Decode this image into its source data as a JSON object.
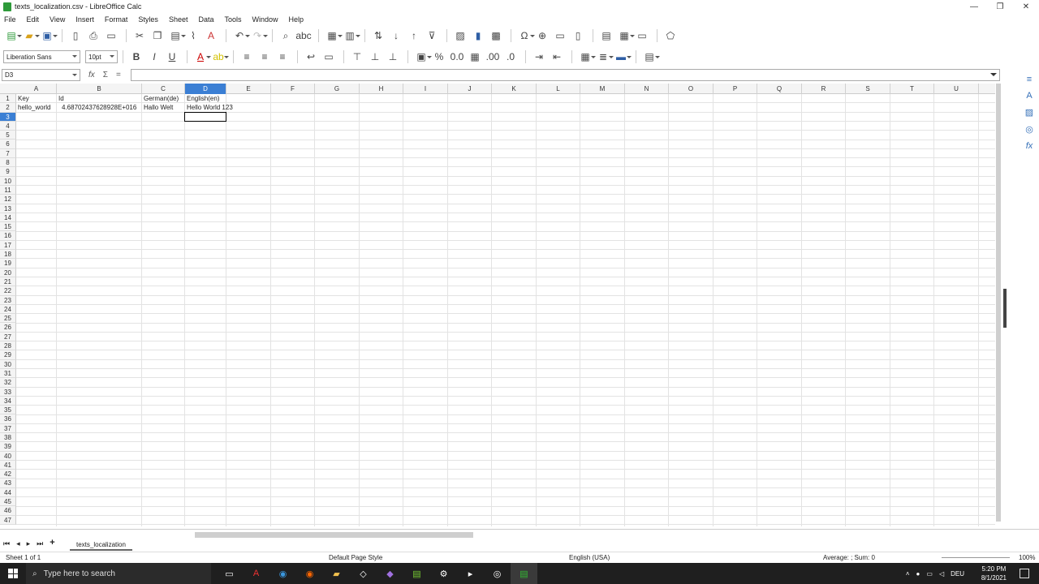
{
  "window": {
    "title": "texts_localization.csv - LibreOffice Calc",
    "controls": [
      "—",
      "❐",
      "✕"
    ]
  },
  "menu": [
    "File",
    "Edit",
    "View",
    "Insert",
    "Format",
    "Styles",
    "Sheet",
    "Data",
    "Tools",
    "Window",
    "Help"
  ],
  "toolbar": {
    "font_name": "Liberation Sans",
    "font_size": "10pt"
  },
  "formula_bar": {
    "cell_ref": "D3",
    "fx": "fx",
    "sum": "Σ",
    "equals": "=",
    "content": ""
  },
  "columns": [
    "A",
    "B",
    "C",
    "D",
    "E",
    "F",
    "G",
    "H",
    "I",
    "J",
    "K",
    "L",
    "M",
    "N",
    "O",
    "P",
    "Q",
    "R",
    "S",
    "T",
    "U"
  ],
  "active_column": "D",
  "active_row": 3,
  "rows": [
    "1",
    "2",
    "3",
    "4",
    "5",
    "6",
    "7",
    "8",
    "9",
    "10",
    "11",
    "12",
    "13",
    "14",
    "15",
    "16",
    "17",
    "18",
    "19",
    "20",
    "21",
    "22",
    "23",
    "24",
    "25",
    "26",
    "27",
    "28",
    "29",
    "30",
    "31",
    "32",
    "33",
    "34",
    "35",
    "36",
    "37",
    "38",
    "39",
    "40",
    "41",
    "42",
    "43",
    "44",
    "45",
    "46",
    "47"
  ],
  "cells": {
    "A1": "Key",
    "B1": "Id",
    "C1": "German(de)",
    "D1": "English(en)",
    "A2": "hello_world",
    "B2": "4.68702437628928E+016",
    "C2": "Hallo Welt",
    "D2": "Hello World 123"
  },
  "sheet_tab": "texts_localization",
  "status": {
    "sheet": "Sheet 1 of 1",
    "page_style": "Default Page Style",
    "language": "English (USA)",
    "summary": "Average: ; Sum: 0",
    "zoom": "100%"
  },
  "taskbar": {
    "search_placeholder": "Type here to search",
    "time": "5:20 PM",
    "date": "8/1/2021",
    "lang": "DEU"
  }
}
